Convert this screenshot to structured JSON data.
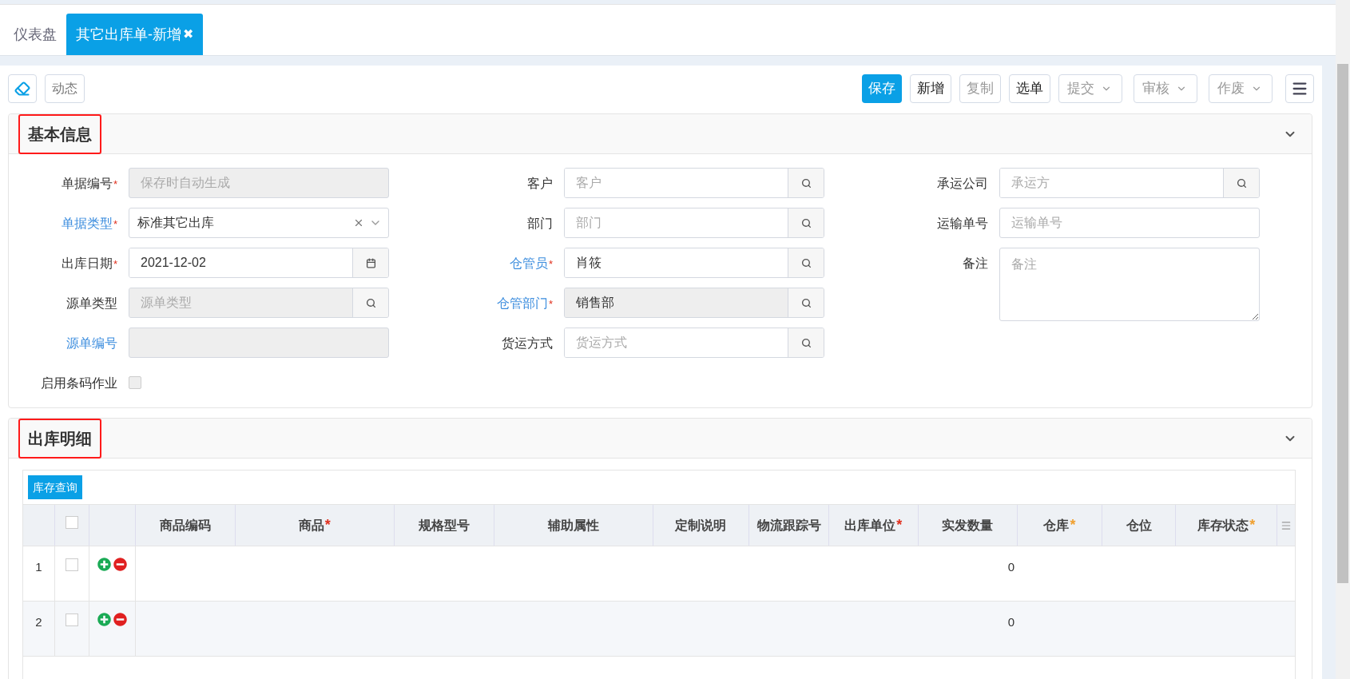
{
  "tabs": [
    {
      "label": "仪表盘",
      "selected": false
    },
    {
      "label": "其它出库单-新增",
      "selected": true,
      "close": "✖"
    }
  ],
  "toolbar_left": [
    {
      "kind": "icon"
    },
    {
      "kind": "text",
      "label": "动态"
    }
  ],
  "toolbar_right": [
    {
      "label": "保存",
      "primary": true,
      "disabled": false,
      "dropdown": false
    },
    {
      "label": "新增",
      "primary": false,
      "disabled": false,
      "dropdown": false
    },
    {
      "label": "复制",
      "primary": false,
      "disabled": true,
      "dropdown": false
    },
    {
      "label": "选单",
      "primary": false,
      "disabled": false,
      "dropdown": false
    },
    {
      "label": "提交",
      "primary": false,
      "disabled": true,
      "dropdown": true
    },
    {
      "label": "审核",
      "primary": false,
      "disabled": true,
      "dropdown": true
    },
    {
      "label": "作废",
      "primary": false,
      "disabled": true,
      "dropdown": true
    }
  ],
  "basic_info": {
    "title": "基本信息",
    "highlighted": true,
    "expanded": true,
    "columns": [
      [
        {
          "label": "单据编号",
          "required_mark": "*",
          "linked": false,
          "kind": "text",
          "placeholder": "保存时自动生成",
          "disabled": true
        },
        {
          "label": "单据类型",
          "required_mark": "*",
          "linked": true,
          "kind": "select",
          "value": "标准其它出库",
          "disabled": false
        },
        {
          "label": "出库日期",
          "required_mark": "*",
          "linked": false,
          "kind": "date",
          "value": "2021-12-02",
          "disabled": false
        },
        {
          "label": "源单类型",
          "linked": false,
          "kind": "lookup",
          "placeholder": "源单类型",
          "disabled": true
        },
        {
          "label": "源单编号",
          "linked": true,
          "kind": "text",
          "disabled": true
        },
        {
          "label": "启用条码作业",
          "linked": false,
          "kind": "checkbox",
          "checked": false,
          "disabled": true
        }
      ],
      [
        {
          "label": "客户",
          "linked": false,
          "kind": "lookup",
          "placeholder": "客户",
          "disabled": false
        },
        {
          "label": "部门",
          "linked": false,
          "kind": "lookup",
          "placeholder": "部门",
          "disabled": false
        },
        {
          "label": "仓管员",
          "required_mark": "*",
          "linked": true,
          "kind": "lookup",
          "value": "肖筱",
          "disabled": false
        },
        {
          "label": "仓管部门",
          "required_mark": "*",
          "linked": true,
          "kind": "lookup",
          "value": "销售部",
          "disabled": true
        },
        {
          "label": "货运方式",
          "linked": false,
          "kind": "lookup",
          "placeholder": "货运方式",
          "disabled": false
        }
      ],
      [
        {
          "label": "承运公司",
          "linked": false,
          "kind": "lookup",
          "placeholder": "承运方",
          "disabled": false
        },
        {
          "label": "运输单号",
          "linked": false,
          "kind": "text",
          "placeholder": "运输单号",
          "disabled": false
        },
        {
          "label": "备注",
          "linked": false,
          "kind": "textarea",
          "placeholder": "备注",
          "disabled": false
        }
      ]
    ]
  },
  "details": {
    "title": "出库明细",
    "highlighted": true,
    "expanded": true,
    "toolbar_button": "库存查询",
    "columns": [
      {
        "label": "商品编码"
      },
      {
        "label": "商品",
        "required_mark": "*",
        "color": "#e0301e"
      },
      {
        "label": "规格型号"
      },
      {
        "label": "辅助属性"
      },
      {
        "label": "定制说明"
      },
      {
        "label": "物流跟踪号"
      },
      {
        "label": "出库单位",
        "required_mark": "*",
        "color": "#e0301e"
      },
      {
        "label": "实发数量"
      },
      {
        "label": "仓库",
        "required_mark": "*",
        "color": "#f0a030"
      },
      {
        "label": "仓位"
      },
      {
        "label": "库存状态",
        "required_mark": "*",
        "color": "#f0a030"
      }
    ],
    "header_checked": false,
    "rows": [
      {
        "number": "1",
        "checked": false,
        "quantity": "0"
      },
      {
        "number": "2",
        "checked": false,
        "quantity": "0"
      }
    ]
  }
}
